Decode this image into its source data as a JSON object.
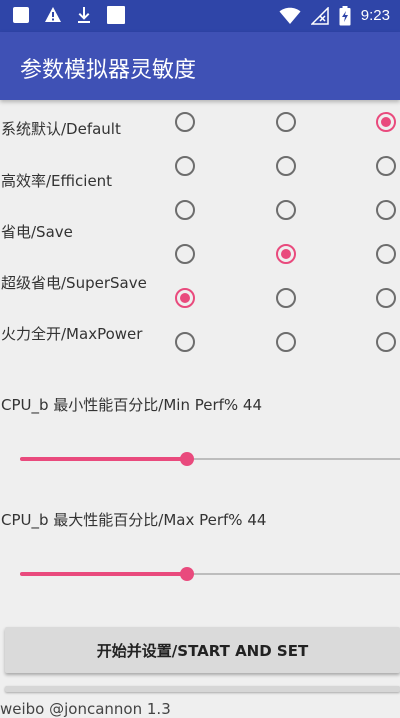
{
  "status_bar": {
    "time": "9:23",
    "icons_left": [
      "square-icon",
      "warning-icon",
      "download-icon",
      "square-icon"
    ],
    "icons_right": [
      "wifi-icon",
      "signal-icon",
      "battery-icon"
    ]
  },
  "app_bar": {
    "title": "参数模拟器灵敏度"
  },
  "modes": [
    {
      "label": "系统默认/Default",
      "selected_column": 3
    },
    {
      "label": "高效率/Efficient",
      "selected_column": 0
    },
    {
      "label": "省电/Save",
      "selected_column": 0
    },
    {
      "label": "超级省电/SuperSave",
      "selected_column": 2
    },
    {
      "label": "火力全开/MaxPower",
      "selected_column": 1
    }
  ],
  "sliders": [
    {
      "label": "CPU_b 最小性能百分比/Min Perf% 44",
      "value_percent": 44
    },
    {
      "label": "CPU_b 最大性能百分比/Max Perf% 44",
      "value_percent": 44
    }
  ],
  "start_button": {
    "label": "开始并设置/START AND SET"
  },
  "footer": {
    "text": "weibo @joncannon 1.3"
  },
  "colors": {
    "primary": "#3f51b5",
    "status_bar": "#2f45a8",
    "accent": "#e94a7d"
  }
}
